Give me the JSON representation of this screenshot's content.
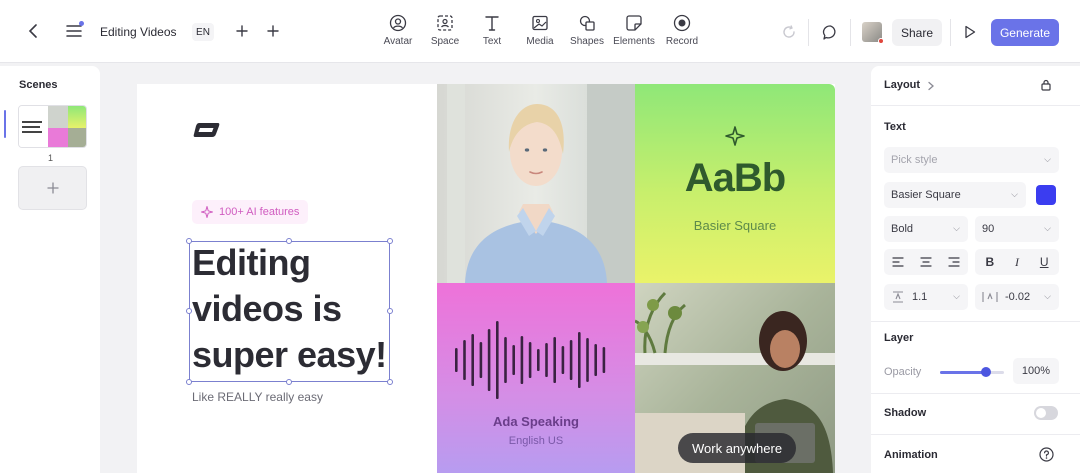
{
  "header": {
    "project_title": "Editing Videos",
    "language": "EN",
    "tools": [
      {
        "label": "Avatar",
        "icon": "avatar-icon"
      },
      {
        "label": "Space",
        "icon": "space-icon"
      },
      {
        "label": "Text",
        "icon": "text-icon"
      },
      {
        "label": "Media",
        "icon": "media-icon"
      },
      {
        "label": "Shapes",
        "icon": "shapes-icon"
      },
      {
        "label": "Elements",
        "icon": "elements-icon"
      },
      {
        "label": "Record",
        "icon": "record-icon"
      }
    ],
    "share_label": "Share",
    "generate_label": "Generate",
    "accent_color": "#6a73e8"
  },
  "scenes": {
    "title": "Scenes",
    "items": [
      {
        "number": "1"
      }
    ]
  },
  "canvas": {
    "badge": "100+ AI features",
    "headline": "Editing videos is super easy!",
    "subline": "Like REALLY really easy",
    "font_card": {
      "sample": "AaBb",
      "font_name": "Basier Square"
    },
    "voice_card": {
      "name": "Ada Speaking",
      "language": "English US"
    },
    "photo_card": {
      "caption": "Work anywhere"
    }
  },
  "properties": {
    "layout_title": "Layout",
    "text_title": "Text",
    "pick_style_placeholder": "Pick style",
    "font_family": "Basier Square",
    "font_color": "#3b3df0",
    "font_weight": "Bold",
    "font_size": "90",
    "line_height": "1.1",
    "letter_spacing": "-0.02",
    "layer_title": "Layer",
    "opacity_label": "Opacity",
    "opacity_value": "100%",
    "opacity_fraction": 1.0,
    "shadow_label": "Shadow",
    "shadow_enabled": false,
    "animation_label": "Animation"
  }
}
